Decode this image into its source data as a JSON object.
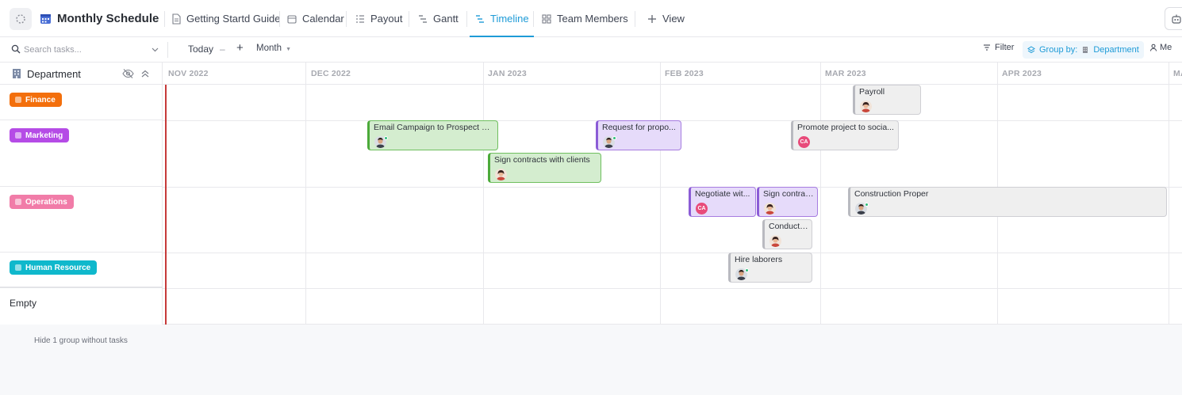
{
  "header": {
    "title": "Monthly Schedule",
    "tabs": [
      {
        "label": "Getting Startd Guide"
      },
      {
        "label": "Calendar"
      },
      {
        "label": "Payout"
      },
      {
        "label": "Gantt"
      },
      {
        "label": "Timeline",
        "active": true
      },
      {
        "label": "Team Members"
      }
    ],
    "add_view_label": "View"
  },
  "toolbar": {
    "search_placeholder": "Search tasks...",
    "today_label": "Today",
    "zoom_minus": "–",
    "zoom_plus": "+",
    "scale_label": "Month",
    "filter_label": "Filter",
    "group_prefix": "Group by:",
    "group_value": "Department",
    "me_label": "Me"
  },
  "left": {
    "column_title": "Department",
    "groups": [
      {
        "label": "Finance",
        "color": "#f36f0c"
      },
      {
        "label": "Marketing",
        "color": "#b54be6"
      },
      {
        "label": "Operations",
        "color": "#f17ca8"
      },
      {
        "label": "Human Resource",
        "color": "#0fb8cc"
      }
    ],
    "empty_label": "Empty"
  },
  "timeline": {
    "months": [
      "NOV 2022",
      "DEC 2022",
      "JAN 2023",
      "FEB 2023",
      "MAR 2023",
      "APR 2023",
      "MA"
    ],
    "tasks": [
      {
        "name": "Payroll",
        "avatar": "photo-woman"
      },
      {
        "name": "Email Campaign to Prospect Cl...",
        "avatar": "photo-man"
      },
      {
        "name": "Request for propo...",
        "avatar": "photo-man"
      },
      {
        "name": "Promote project to socia...",
        "avatar": "CA"
      },
      {
        "name": "Sign contracts with clients",
        "avatar": "photo-woman"
      },
      {
        "name": "Negotiate wit...",
        "avatar": "CA"
      },
      {
        "name": "Sign contrac...",
        "avatar": "photo-woman"
      },
      {
        "name": "Construction Proper",
        "avatar": "photo-man"
      },
      {
        "name": "Conduct ...",
        "avatar": "photo-woman"
      },
      {
        "name": "Hire laborers",
        "avatar": "photo-man"
      }
    ]
  },
  "footer": {
    "hide_label": "Hide 1 group without tasks"
  },
  "colors": {
    "accent": "#1e9bd7",
    "today_line": "#c63a3a"
  }
}
